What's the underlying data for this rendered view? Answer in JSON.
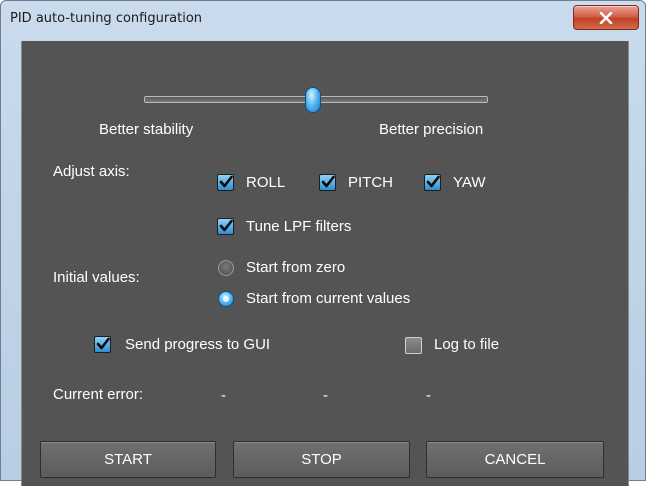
{
  "window": {
    "title": "PID auto-tuning configuration",
    "close_icon": "close-x-icon"
  },
  "slider": {
    "label_left": "Better stability",
    "label_right": "Better precision",
    "value_fraction": 0.49
  },
  "axis": {
    "label": "Adjust axis:",
    "options": [
      {
        "label": "ROLL",
        "checked": true
      },
      {
        "label": "PITCH",
        "checked": true
      },
      {
        "label": "YAW",
        "checked": true
      }
    ]
  },
  "lpf": {
    "label": "Tune LPF filters",
    "checked": true
  },
  "initial": {
    "label": "Initial values:",
    "options": [
      {
        "label": "Start from zero",
        "selected": false
      },
      {
        "label": "Start from current values",
        "selected": true
      }
    ]
  },
  "send_progress": {
    "label": "Send progress to GUI",
    "checked": true
  },
  "log_to_file": {
    "label": "Log to file",
    "checked": false
  },
  "current_error": {
    "label": "Current error:",
    "values": [
      "-",
      "-",
      "-"
    ]
  },
  "buttons": {
    "start": "START",
    "stop": "STOP",
    "cancel": "CANCEL"
  },
  "colors": {
    "panel_bg": "#545454",
    "accent_blue": "#2d8fd3",
    "close_red": "#c24128"
  }
}
